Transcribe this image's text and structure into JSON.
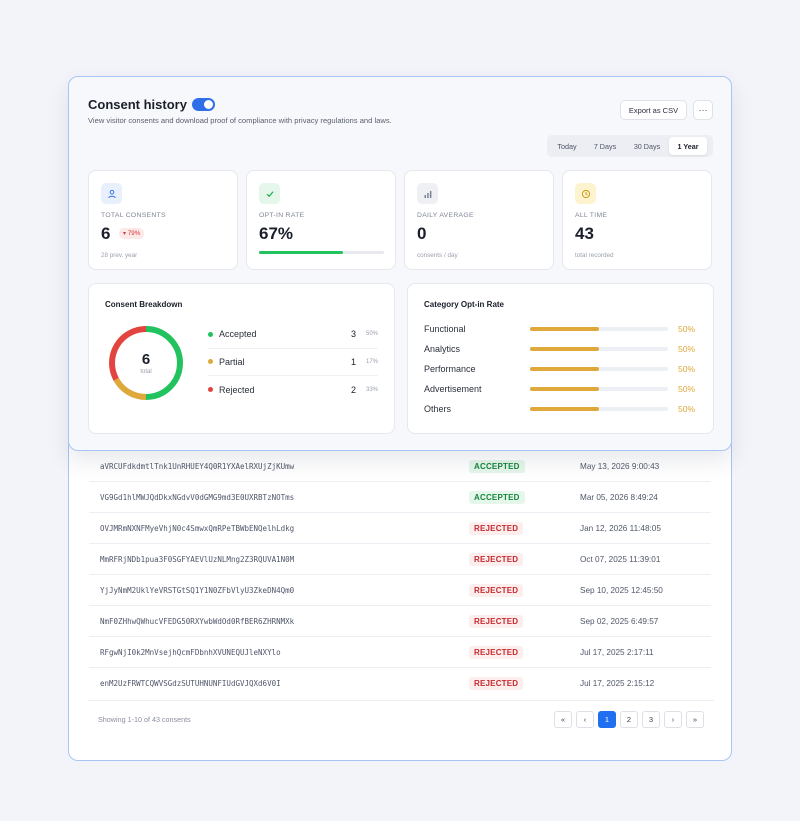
{
  "header": {
    "title": "Consent history",
    "subtitle": "View visitor consents and download proof of compliance with privacy regulations and laws.",
    "export_label": "Export as CSV",
    "more_label": "···"
  },
  "date_range": {
    "options": [
      "Today",
      "7 Days",
      "30 Days",
      "1 Year"
    ],
    "selected": "1 Year"
  },
  "stats": {
    "total": {
      "label": "TOTAL CONSENTS",
      "value": "6",
      "delta": "▾ 79%",
      "sub": "28 prev. year"
    },
    "optin": {
      "label": "OPT-IN RATE",
      "value": "67%",
      "progress": 0.67
    },
    "daily": {
      "label": "DAILY AVERAGE",
      "value": "0",
      "sub": "consents / day"
    },
    "alltime": {
      "label": "ALL TIME",
      "value": "43",
      "sub": "total recorded"
    }
  },
  "breakdown": {
    "title": "Consent Breakdown",
    "total": "6",
    "total_label": "total",
    "items": [
      {
        "label": "Accepted",
        "count": "3",
        "pct": "50%",
        "color": "#22c35e",
        "share": 0.5
      },
      {
        "label": "Partial",
        "count": "1",
        "pct": "17%",
        "color": "#dfa83a",
        "share": 0.17
      },
      {
        "label": "Rejected",
        "count": "2",
        "pct": "33%",
        "color": "#e2453f",
        "share": 0.33
      }
    ]
  },
  "categories": {
    "title": "Category Opt-in Rate",
    "items": [
      {
        "label": "Functional",
        "pct": "50%",
        "rate": 0.5
      },
      {
        "label": "Analytics",
        "pct": "50%",
        "rate": 0.5
      },
      {
        "label": "Performance",
        "pct": "50%",
        "rate": 0.5
      },
      {
        "label": "Advertisement",
        "pct": "50%",
        "rate": 0.5
      },
      {
        "label": "Others",
        "pct": "50%",
        "rate": 0.5
      }
    ]
  },
  "table": {
    "rows": [
      {
        "id": "aVRCUFdkdmtlTnk1UnRHUEY4Q0R1YXAelRXUjZjKUmw",
        "status": "ACCEPTED",
        "date": "May 13, 2026 9:00:43"
      },
      {
        "id": "VG9Gd1hlMWJQdDkxNGdvV0dGMG9md3E0UXRBTzNOTms",
        "status": "ACCEPTED",
        "date": "Mar 05, 2026 8:49:24"
      },
      {
        "id": "OVJMRmNXNFMyeVhjN0c4SmwxQmRPeTBWbENQelhLdkg",
        "status": "REJECTED",
        "date": "Jan 12, 2026 11:48:05"
      },
      {
        "id": "MmRFRjNDb1pua3F0SGFYAEVlUzNLMng2Z3RQUVA1N0M",
        "status": "REJECTED",
        "date": "Oct 07, 2025 11:39:01"
      },
      {
        "id": "YjJyNmM2UklYeVRSTGtSQ1Y1N0ZFbVlyU3ZkeDN4Qm0",
        "status": "REJECTED",
        "date": "Sep 10, 2025 12:45:50"
      },
      {
        "id": "NmF0ZHhwQWhucVFEDG50RXYwbWdOd0RfBER6ZHRNMXk",
        "status": "REJECTED",
        "date": "Sep 02, 2025 6:49:57"
      },
      {
        "id": "RFgwNjI0k2MnVsejhQcmFDbnhXVUNEQUJleNXYlo",
        "status": "REJECTED",
        "date": "Jul 17, 2025 2:17:11"
      },
      {
        "id": "enM2UzFRWTCQWVSGdzSUTUHNUNFIUdGVJQXd6V0I",
        "status": "REJECTED",
        "date": "Jul 17, 2025 2:15:12"
      }
    ],
    "showing": "Showing 1-10 of 43 consents",
    "pager": {
      "first": "«",
      "prev": "‹",
      "pages": [
        "1",
        "2",
        "3"
      ],
      "current": "1",
      "next": "›",
      "last": "»"
    }
  }
}
